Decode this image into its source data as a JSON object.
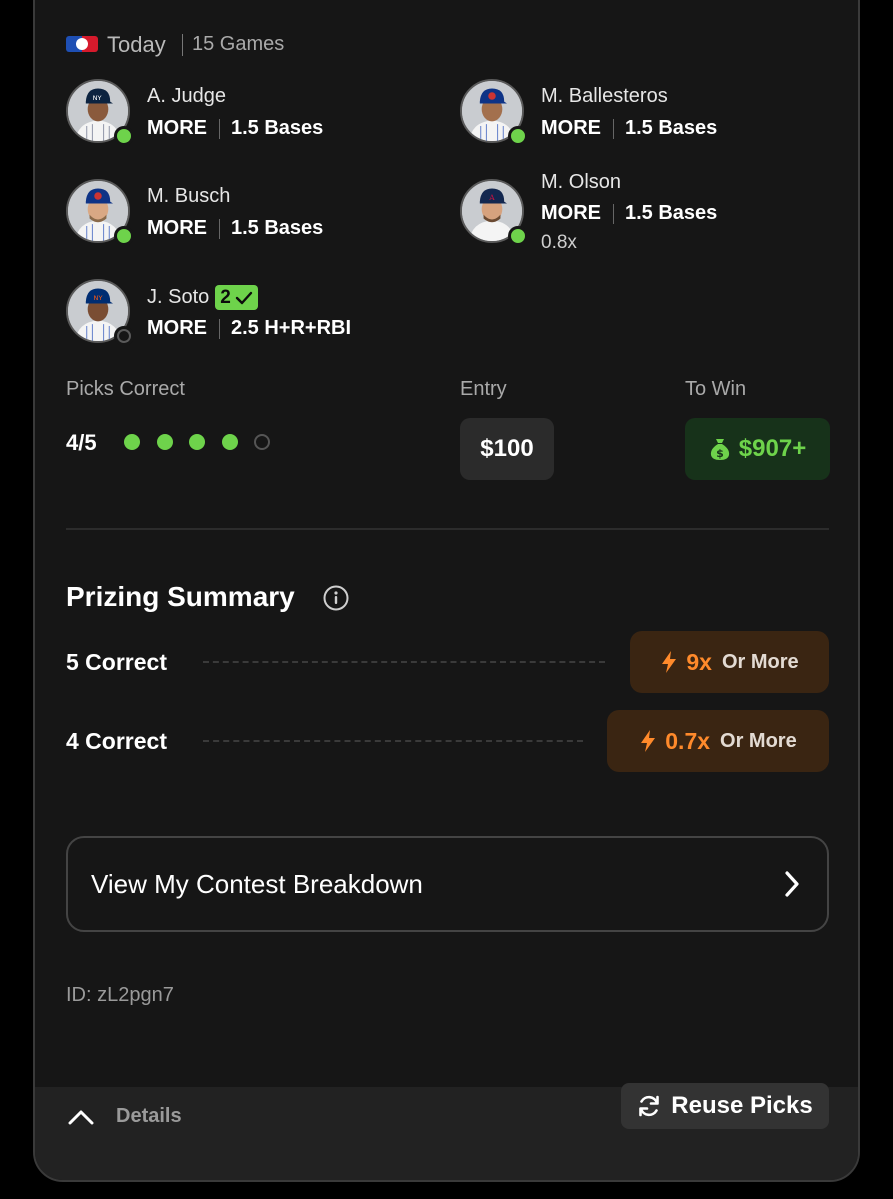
{
  "header": {
    "league_icon": "mlb-logo",
    "day": "Today",
    "games": "15 Games"
  },
  "players": [
    {
      "name": "A. Judge",
      "direction": "MORE",
      "line": "1.5 Bases",
      "status": "hit"
    },
    {
      "name": "M. Ballesteros",
      "direction": "MORE",
      "line": "1.5 Bases",
      "status": "hit"
    },
    {
      "name": "M. Busch",
      "direction": "MORE",
      "line": "1.5 Bases",
      "status": "hit"
    },
    {
      "name": "M. Olson",
      "direction": "MORE",
      "line": "1.5 Bases",
      "multiplier": "0.8x",
      "status": "hit"
    },
    {
      "name": "J. Soto",
      "badge": "2",
      "direction": "MORE",
      "line": "2.5 H+R+RBI",
      "status": "pending"
    }
  ],
  "summary": {
    "picks_label": "Picks Correct",
    "picks_value": "4/5",
    "picks_correct": 4,
    "picks_total": 5,
    "entry_label": "Entry",
    "entry_value": "$100",
    "win_label": "To Win",
    "win_value": "$907+",
    "win_icon": "money-bag-icon"
  },
  "prizing": {
    "title": "Prizing Summary",
    "rows": [
      {
        "label": "5 Correct",
        "multiplier": "9x",
        "suffix": "Or More"
      },
      {
        "label": "4 Correct",
        "multiplier": "0.7x",
        "suffix": "Or More"
      }
    ]
  },
  "breakdown_label": "View My Contest Breakdown",
  "contest_id": "ID: zL2pgn7",
  "footer": {
    "details_label": "Details",
    "reuse_label": "Reuse Picks"
  },
  "colors": {
    "accent_green": "#6ed34b",
    "accent_orange": "#ff8a2b",
    "card_bg": "#161616"
  }
}
